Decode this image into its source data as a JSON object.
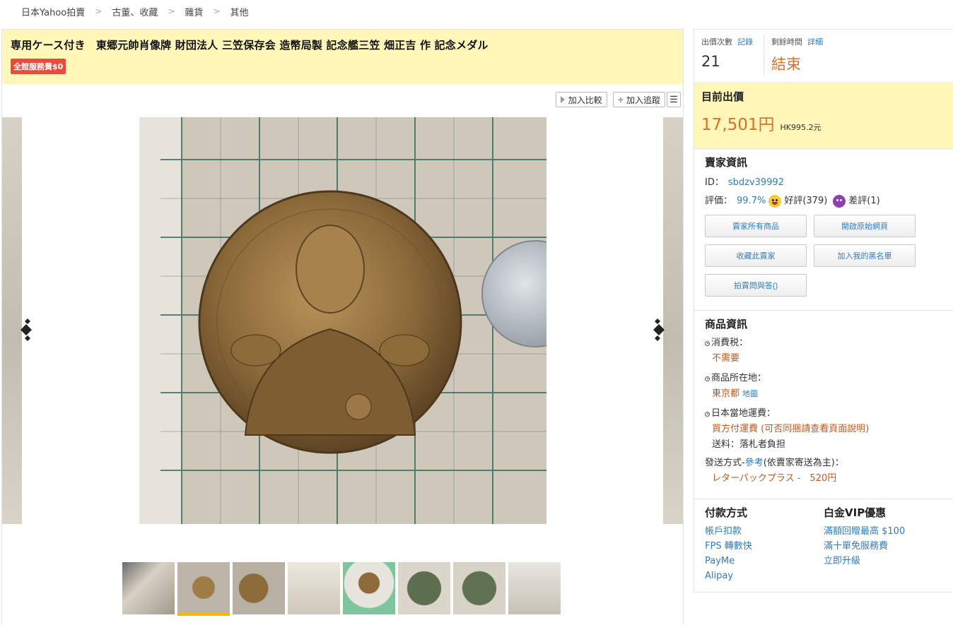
{
  "breadcrumb": [
    "日本Yahoo拍賣",
    "古董、收藏",
    "雜貨",
    "其他"
  ],
  "item": {
    "title": "専用ケース付き　東郷元帥肖像牌 財団法人 三笠保存会 造幣局製 記念艦三笠 畑正吉 作 記念メダル",
    "fee_badge": "全館服務費$0"
  },
  "toolbar": {
    "compare_label": "加入比較",
    "track_label": "加入追蹤",
    "menu_icon": "☰"
  },
  "gallery": {
    "thumb_count": 8,
    "active_index": 1
  },
  "bid": {
    "count_label": "出價次數",
    "count_link": "記錄",
    "count_value": "21",
    "time_label": "剩餘時間",
    "time_link": "詳細",
    "time_value": "結束"
  },
  "price": {
    "label": "目前出價",
    "value": "17,501円",
    "hk": "HK995.2元"
  },
  "seller": {
    "heading": "賣家資訊",
    "id_label": "ID：",
    "id_value": "sbdzv39992",
    "rating_label": "評価：",
    "rating_value": "99.7%",
    "good_label": "好評(379)",
    "bad_label": "差評(1)",
    "buttons": [
      "賣家所有商品",
      "開啟原始網頁",
      "收藏此賣家",
      "加入我的黑名單",
      "拍賣問與答()"
    ]
  },
  "product": {
    "heading": "商品資訊",
    "tax_label": "消費税：",
    "tax_value": "不需要",
    "location_label": "商品所在地：",
    "location_value": "東京都",
    "location_link": "地圖",
    "shipping_label": "日本當地運費：",
    "shipping_value": "買方付運費 (可否同捆請查看頁面說明)",
    "shipping_sub": "送料：落札者負担",
    "method_prefix": "發送方式- ",
    "method_link": "參考",
    "method_suffix": "(依賣家寄送為主)：",
    "method_value": "レターパックプラス -　520円"
  },
  "payment": {
    "heading": "付款方式",
    "items": [
      "帳戶扣款",
      "FPS 轉數快",
      "PayMe",
      "Alipay"
    ]
  },
  "vip": {
    "heading": "白金VIP優惠",
    "items": [
      "滿額回贈最高 $100",
      "滿十單免服務費",
      "立即升級"
    ]
  },
  "colors": {
    "highlight_bg": "#fff6b8",
    "accent_orange": "#d9702a",
    "link_blue": "#2f7bbf",
    "badge_red": "#e84c3d",
    "active_thumb": "#f5b800"
  }
}
